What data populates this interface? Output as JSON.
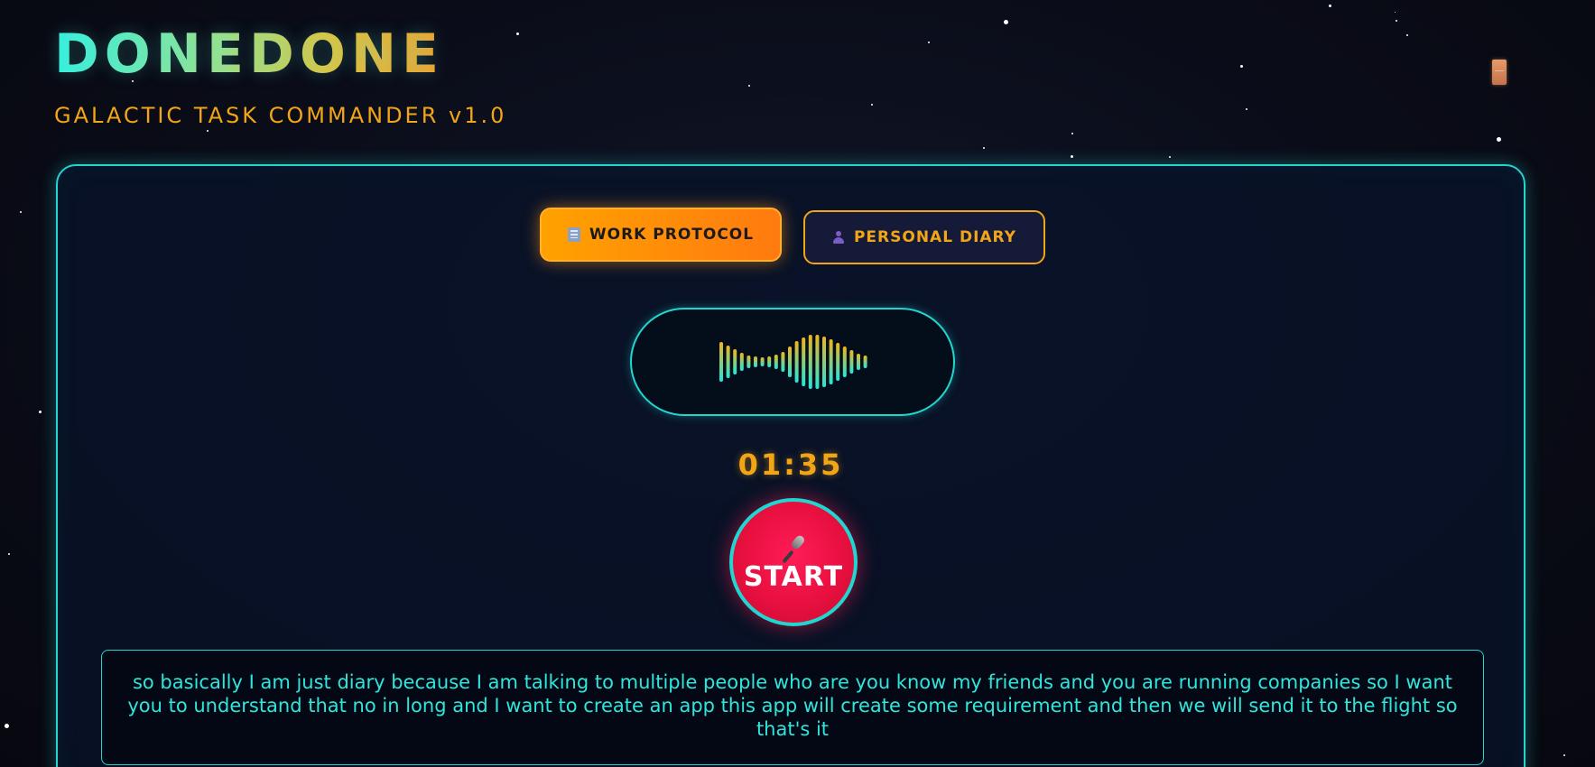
{
  "app": {
    "logo": "DONEDONE",
    "subtitle": "GALACTIC TASK COMMANDER v1.0"
  },
  "modes": [
    {
      "label": "WORK PROTOCOL",
      "icon": "office-building-icon",
      "active": true
    },
    {
      "label": "PERSONAL DIARY",
      "icon": "person-silhouette-icon",
      "active": false
    }
  ],
  "recorder": {
    "timer": "01:35",
    "button_label": "START",
    "button_icon": "microphone-icon"
  },
  "transcript": {
    "text": "so basically I am just diary because I am talking to multiple people who are you know my friends and you are running companies so I want you to understand that no in long and I want to create an app this app will create some requirement and then we will send it to the flight so that's it"
  },
  "colors": {
    "accent_cyan": "#22d6cf",
    "accent_orange": "#f2a516",
    "record_red": "#e8103f",
    "background": "#0a0c16"
  }
}
